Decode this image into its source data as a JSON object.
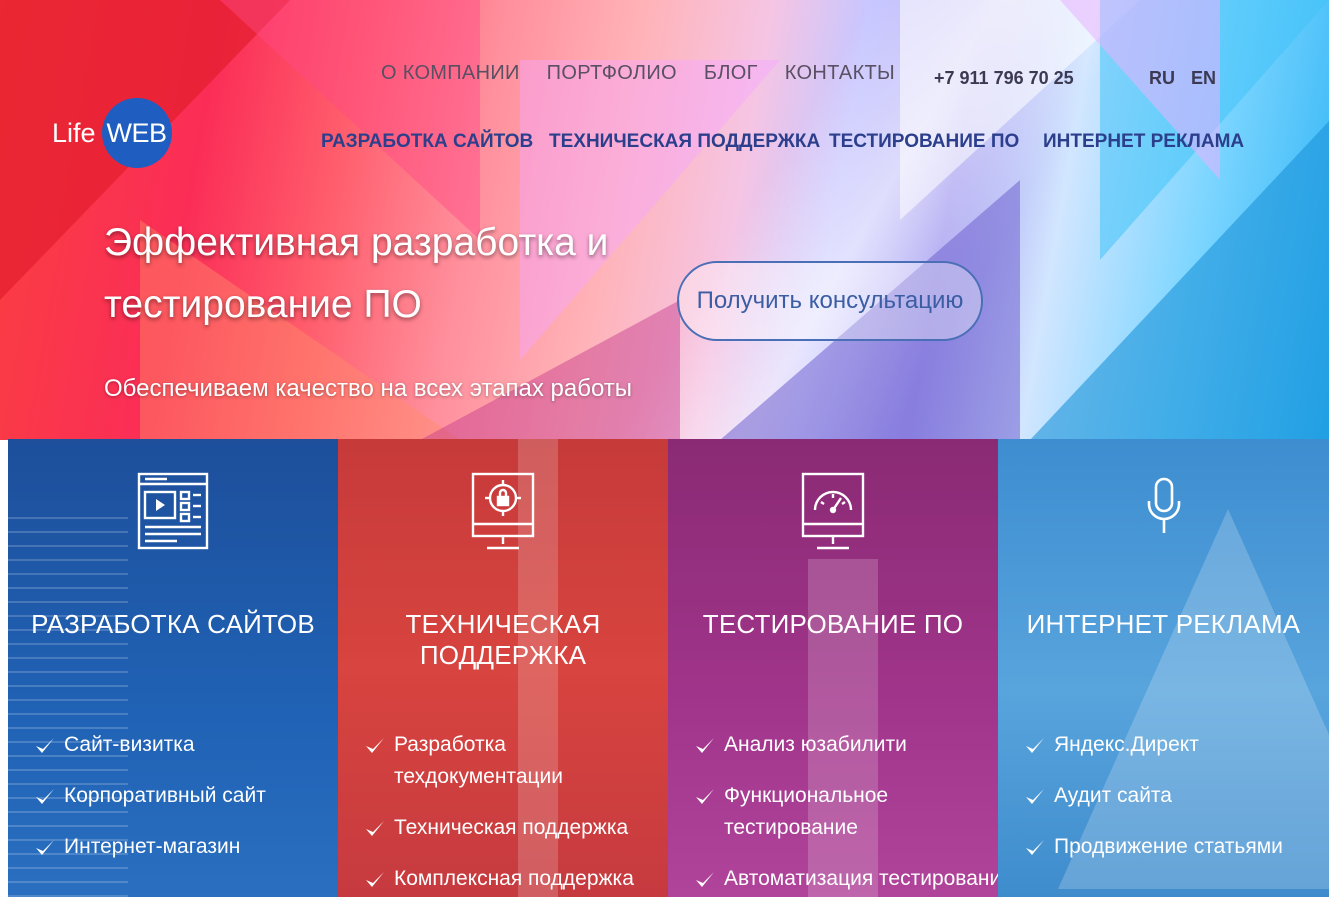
{
  "brand": {
    "life": "Life",
    "web": "WEB"
  },
  "topnav": [
    "О КОМПАНИИ",
    "ПОРТФОЛИО",
    "БЛОГ",
    "КОНТАКТЫ"
  ],
  "phone": "+7 911 796 70 25",
  "languages": [
    "RU",
    "EN"
  ],
  "service_nav": [
    "РАЗРАБОТКА САЙТОВ",
    "ТЕХНИЧЕСКАЯ ПОДДЕРЖКА",
    "ТЕСТИРОВАНИЕ ПО",
    "ИНТЕРНЕТ РЕКЛАМА"
  ],
  "hero": {
    "headline_line1": "Эффективная разработка и",
    "headline_line2": "тестирование ПО",
    "subline": "Обеспечиваем качество на всех этапах работы",
    "cta": "Получить консультацию"
  },
  "cards": [
    {
      "title": "РАЗРАБОТКА САЙТОВ",
      "icon": "website-layout-icon",
      "color": "#2062b5",
      "items": [
        "Сайт-визитка",
        "Корпоративный сайт",
        "Интернет-магазин"
      ]
    },
    {
      "title": "ТЕХНИЧЕСКАЯ ПОДДЕРЖКА",
      "icon": "monitor-lock-icon",
      "color": "#d8443f",
      "items": [
        "Разработка техдокументации",
        "Техническая поддержка",
        "Комплексная поддержка"
      ]
    },
    {
      "title": "ТЕСТИРОВАНИЕ ПО",
      "icon": "monitor-gauge-icon",
      "color": "#a0348a",
      "items": [
        "Анализ юзабилити",
        "Функциональное тестирование",
        "Автоматизация тестирование"
      ]
    },
    {
      "title": "ИНТЕРНЕТ РЕКЛАМА",
      "icon": "microphone-icon",
      "color": "#58a4dd",
      "items": [
        "Яндекс.Директ",
        "Аудит сайта",
        "Продвижение статьями"
      ]
    }
  ]
}
